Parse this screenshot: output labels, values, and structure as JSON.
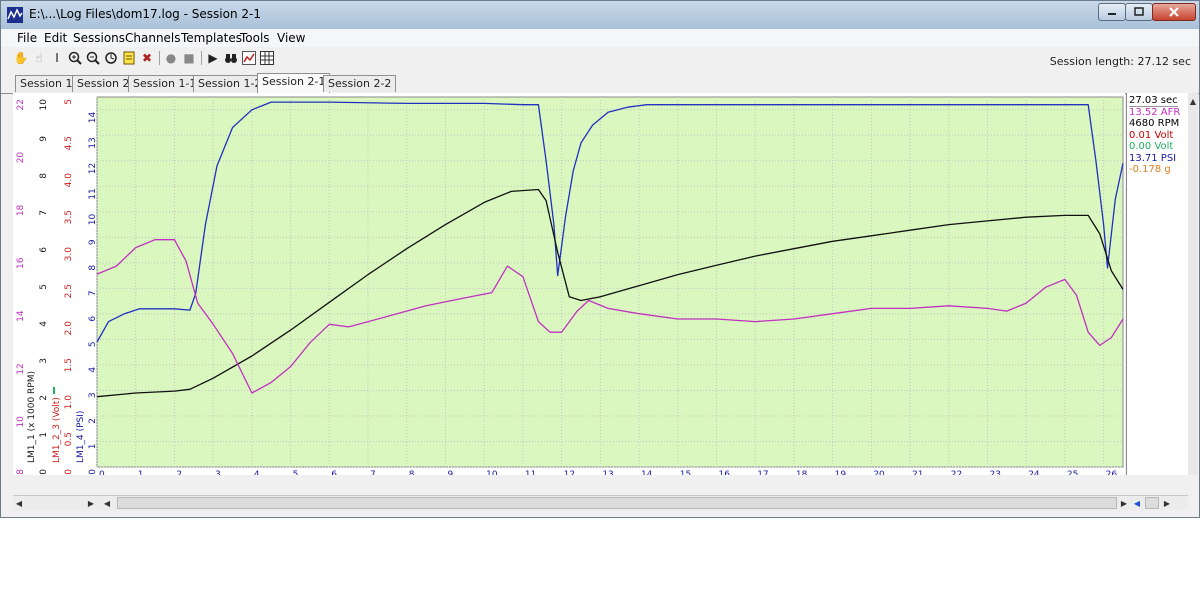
{
  "window": {
    "title": "E:\\...\\Log Files\\dom17.log - Session 2-1"
  },
  "menu": [
    "File",
    "Edit",
    "Sessions",
    "Channels",
    "Templates",
    "Tools",
    "View"
  ],
  "session_length": "Session length:  27.12 sec",
  "tabs": [
    {
      "label": "Session 1",
      "active": false
    },
    {
      "label": "Session 2",
      "active": false
    },
    {
      "label": "Session 1-1",
      "active": false
    },
    {
      "label": "Session 1-2",
      "active": false
    },
    {
      "label": "Session 2-1",
      "active": true
    },
    {
      "label": "Session 2-2",
      "active": false
    }
  ],
  "toolbar": [
    "hand-icon",
    "pan-icon",
    "cursor-icon",
    "zoom-in-icon",
    "zoom-out-icon",
    "zoom-reset-icon",
    "notes-icon",
    "delete-icon",
    "record-icon",
    "stop-icon",
    "play-icon",
    "binoculars-icon",
    "chart-icon",
    "table-icon"
  ],
  "readout": [
    {
      "text": "27.03 sec",
      "color": "#000000"
    },
    {
      "text": "13.52 AFR",
      "color": "#c030c0"
    },
    {
      "text": "4680 RPM",
      "color": "#000000"
    },
    {
      "text": "0.01 Volt",
      "color": "#cc0000"
    },
    {
      "text": "0.00 Volt",
      "color": "#20b060"
    },
    {
      "text": "13.71 PSI",
      "color": "#1a1aa0"
    },
    {
      "text": "-0.178 g",
      "color": "#e08020"
    }
  ],
  "chart_data": {
    "type": "line",
    "background": "#daf7bf",
    "x_ticks": [
      0,
      1,
      2,
      3,
      4,
      5,
      6,
      7,
      8,
      9,
      10,
      11,
      12,
      13,
      14,
      15,
      16,
      17,
      18,
      19,
      20,
      21,
      22,
      23,
      24,
      25,
      26
    ],
    "xlim": [
      0,
      26.5
    ],
    "axes": [
      {
        "name": "afr",
        "label": "",
        "color": "#c030c0",
        "ticks": [
          "8",
          "10",
          "12",
          "14",
          "16",
          "18",
          "20",
          "22"
        ],
        "tick_values": [
          8,
          10,
          12,
          14,
          16,
          18,
          20,
          22
        ],
        "lim": [
          8,
          22
        ]
      },
      {
        "name": "rpm",
        "label": "LM1_1 (x 1000 RPM)",
        "color": "#1a1a1a",
        "ticks": [
          "0",
          "1",
          "2",
          "3",
          "4",
          "5",
          "6",
          "7",
          "8",
          "9",
          "10"
        ],
        "tick_values": [
          0,
          1,
          2,
          3,
          4,
          5,
          6,
          7,
          8,
          9,
          10
        ],
        "lim": [
          0,
          10
        ]
      },
      {
        "name": "volt",
        "label": "LM1_2_3 (Volt)",
        "color": "#cc2020",
        "ticks": [
          "0.0",
          "0.5",
          "1.0",
          "1.5",
          "2.0",
          "2.5",
          "3.0",
          "3.5",
          "4.0",
          "4.5",
          "5"
        ],
        "tick_values": [
          0,
          0.5,
          1,
          1.5,
          2,
          2.5,
          3,
          3.5,
          4,
          4.5,
          5
        ],
        "lim": [
          0,
          5
        ]
      },
      {
        "name": "psi",
        "label": "LM1_4 (PSI)",
        "color": "#1a1aa0",
        "ticks": [
          "0",
          "1",
          "2",
          "3",
          "4",
          "5",
          "6",
          "7",
          "8",
          "9",
          "10",
          "11",
          "12",
          "13",
          "14"
        ],
        "tick_values": [
          0,
          1,
          2,
          3,
          4,
          5,
          6,
          7,
          8,
          9,
          10,
          11,
          12,
          13,
          14
        ],
        "lim": [
          0,
          14.5
        ]
      }
    ],
    "series": [
      {
        "axis": "psi",
        "color": "#2030c0",
        "x": [
          0,
          0.3,
          0.7,
          1.1,
          1.5,
          2.0,
          2.4,
          2.55,
          2.8,
          3.1,
          3.5,
          4.0,
          4.5,
          5.0,
          6.0,
          8.0,
          10.0,
          11.0,
          11.4,
          11.6,
          11.8,
          11.9,
          12.1,
          12.3,
          12.5,
          12.8,
          13.2,
          13.7,
          14.2,
          15.0,
          17.0,
          20.0,
          23.0,
          25.0,
          25.6,
          25.8,
          26.0,
          26.1,
          26.3,
          26.5
        ],
        "y": [
          4.9,
          5.7,
          6.0,
          6.2,
          6.2,
          6.2,
          6.15,
          6.8,
          9.5,
          11.8,
          13.3,
          14.0,
          14.3,
          14.3,
          14.3,
          14.25,
          14.25,
          14.2,
          14.2,
          12.0,
          9.5,
          7.5,
          9.8,
          11.6,
          12.7,
          13.4,
          13.9,
          14.1,
          14.2,
          14.2,
          14.2,
          14.2,
          14.2,
          14.2,
          14.2,
          12.0,
          9.5,
          7.8,
          10.5,
          11.9
        ]
      },
      {
        "axis": "rpm",
        "color": "#111111",
        "x": [
          0,
          1.0,
          2.0,
          2.4,
          3.0,
          4.0,
          5.0,
          6.0,
          7.0,
          8.0,
          9.0,
          10.0,
          10.7,
          11.4,
          11.6,
          11.9,
          12.2,
          12.5,
          13.0,
          14.0,
          15.0,
          16.0,
          17.0,
          18.0,
          19.0,
          20.0,
          21.0,
          22.0,
          23.0,
          24.0,
          25.0,
          25.6,
          25.9,
          26.2,
          26.5
        ],
        "y": [
          1.9,
          2.0,
          2.05,
          2.1,
          2.4,
          3.0,
          3.7,
          4.45,
          5.2,
          5.9,
          6.55,
          7.15,
          7.45,
          7.5,
          7.2,
          5.8,
          4.6,
          4.5,
          4.6,
          4.9,
          5.2,
          5.45,
          5.7,
          5.9,
          6.1,
          6.25,
          6.4,
          6.55,
          6.65,
          6.75,
          6.8,
          6.8,
          6.3,
          5.3,
          4.8
        ]
      },
      {
        "axis": "afr",
        "color": "#c030c0",
        "x": [
          0,
          0.5,
          1.0,
          1.5,
          2.0,
          2.3,
          2.6,
          3.0,
          3.5,
          4.0,
          4.5,
          5.0,
          5.5,
          6.0,
          6.5,
          7.5,
          8.5,
          9.5,
          10.2,
          10.6,
          11.0,
          11.4,
          11.7,
          12.0,
          12.4,
          12.7,
          13.2,
          14.0,
          15.0,
          16.0,
          17.0,
          18.0,
          19.0,
          20.0,
          21.0,
          22.0,
          23.0,
          23.5,
          24.0,
          24.5,
          25.0,
          25.3,
          25.6,
          25.9,
          26.2,
          26.5
        ],
        "y": [
          15.3,
          15.6,
          16.3,
          16.6,
          16.6,
          15.8,
          14.2,
          13.4,
          12.3,
          10.8,
          11.2,
          11.8,
          12.7,
          13.4,
          13.3,
          13.7,
          14.1,
          14.4,
          14.6,
          15.6,
          15.2,
          13.5,
          13.1,
          13.1,
          13.9,
          14.3,
          14.0,
          13.8,
          13.6,
          13.6,
          13.5,
          13.6,
          13.8,
          14.0,
          14.0,
          14.1,
          14.0,
          13.9,
          14.2,
          14.8,
          15.1,
          14.5,
          13.1,
          12.6,
          12.9,
          13.6
        ]
      }
    ]
  }
}
